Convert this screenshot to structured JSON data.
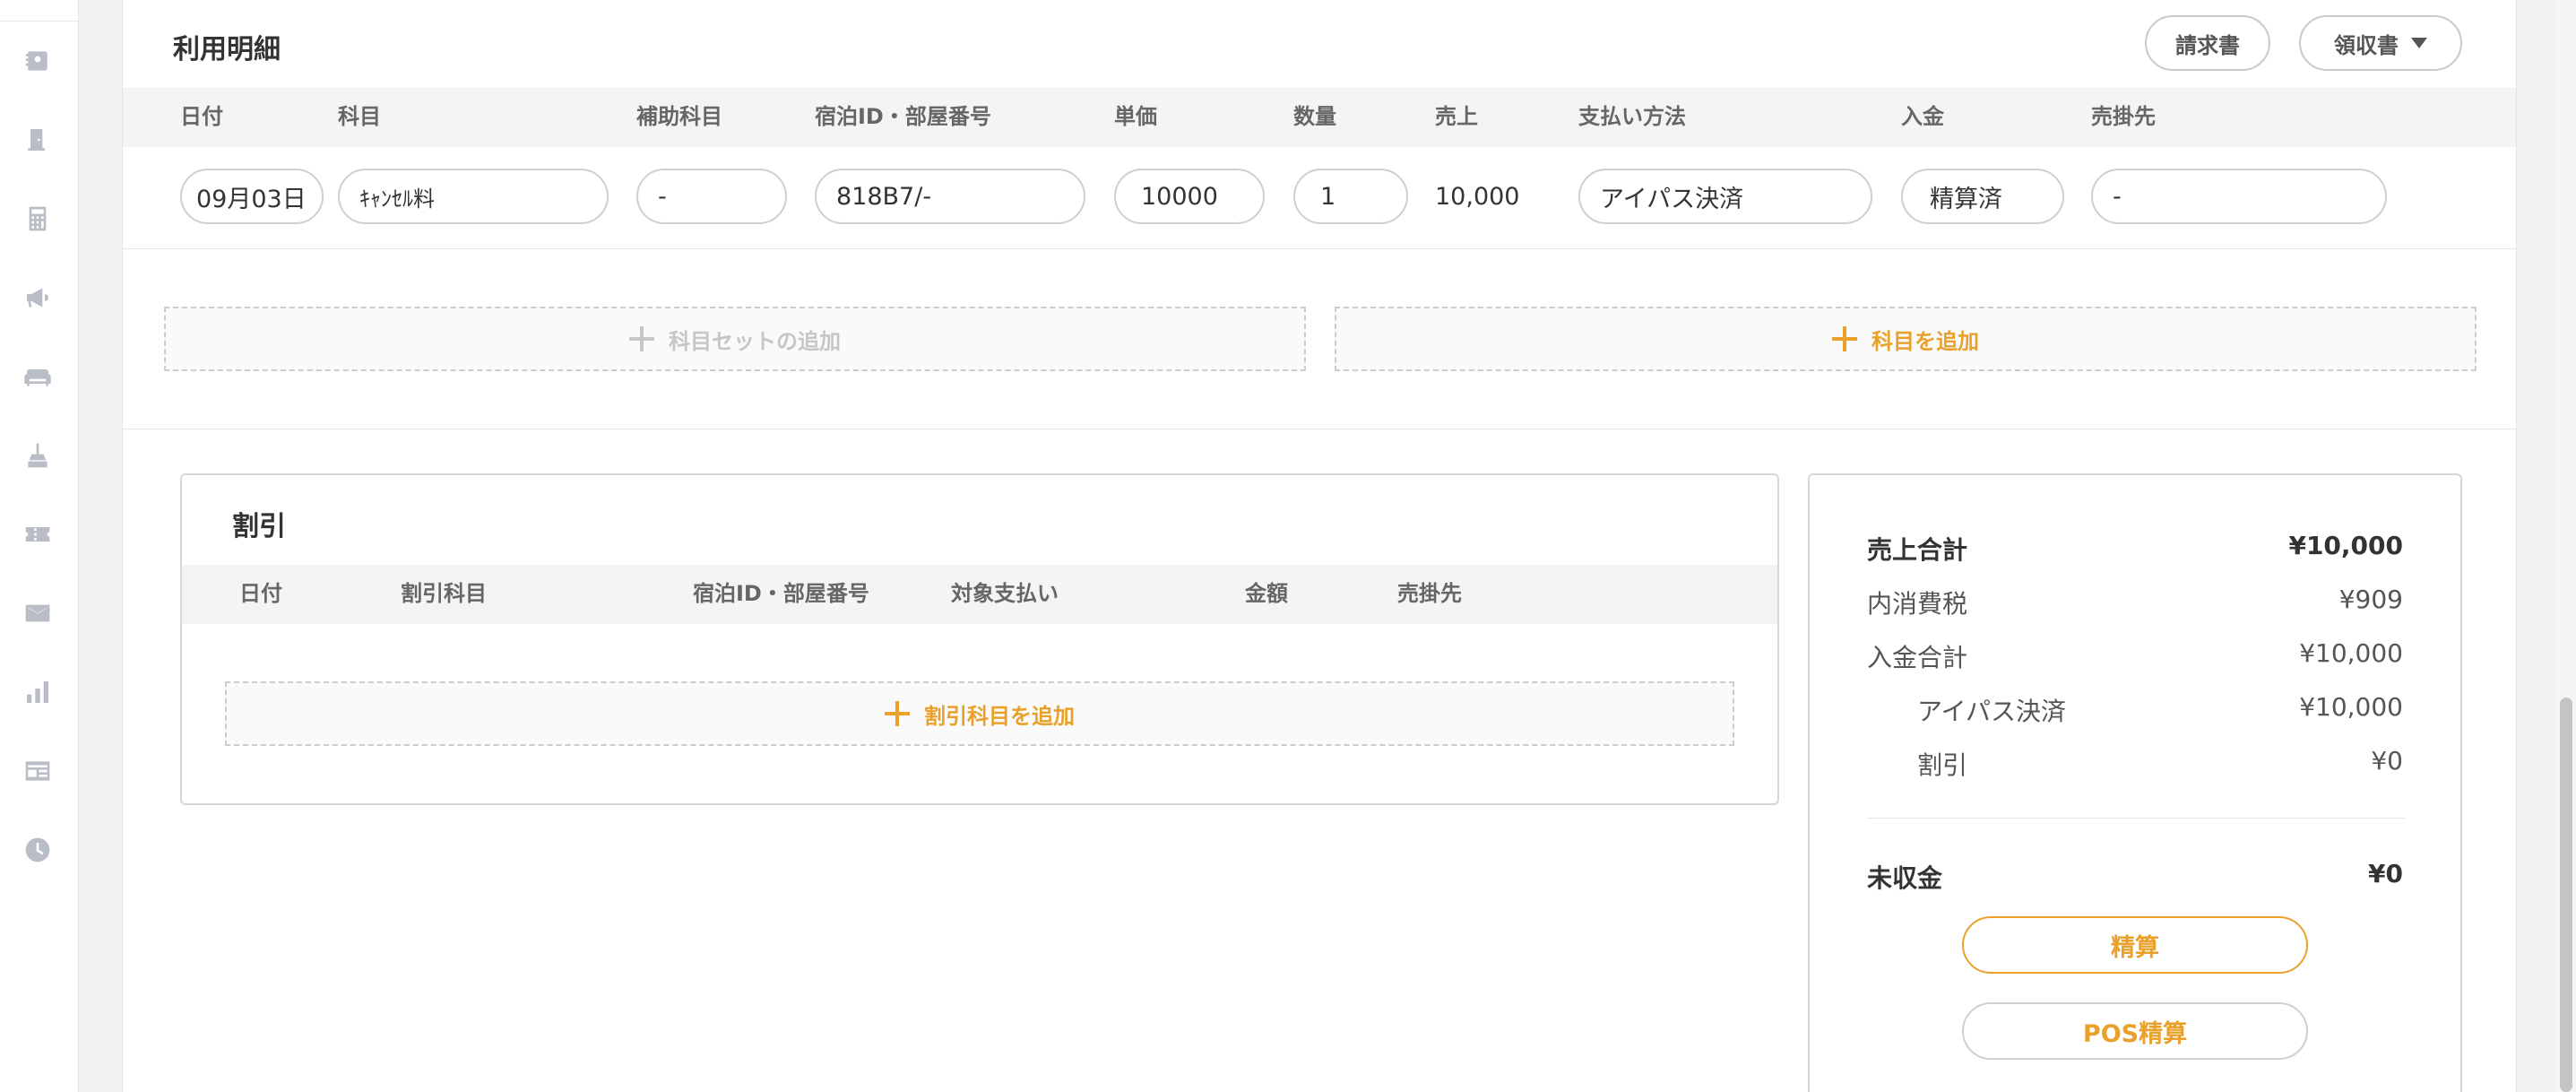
{
  "sidebar": {
    "icons": [
      "contact-book-icon",
      "door-icon",
      "calculator-icon",
      "megaphone-icon",
      "sofa-icon",
      "broom-icon",
      "ticket-icon",
      "mail-icon",
      "bar-chart-icon",
      "news-icon",
      "clock-icon"
    ]
  },
  "usage": {
    "title": "利用明細",
    "invoice_label": "請求書",
    "receipt_label": "領収書",
    "headers": {
      "date": "日付",
      "item": "科目",
      "sub_item": "補助科目",
      "stay_room": "宿泊ID・部屋番号",
      "unit_price": "単価",
      "qty": "数量",
      "sales": "売上",
      "payment_method": "支払い方法",
      "deposit": "入金",
      "receivable": "売掛先"
    },
    "row": {
      "date": "09月03日",
      "item": "ｷｬﾝｾﾙ料",
      "sub_item": "-",
      "stay_room": "818B7/-",
      "unit_price": "10000",
      "qty": "1",
      "sales": "10,000",
      "payment_method": "アイパス決済",
      "deposit": "精算済",
      "receivable": "-"
    },
    "add_set_label": "科目セットの追加",
    "add_item_label": "科目を追加"
  },
  "discount": {
    "title": "割引",
    "headers": {
      "date": "日付",
      "item": "割引科目",
      "stay_room": "宿泊ID・部屋番号",
      "target_payment": "対象支払い",
      "amount": "金額",
      "receivable": "売掛先"
    },
    "add_label": "割引科目を追加"
  },
  "summary": {
    "sales_total_label": "売上合計",
    "sales_total": "¥10,000",
    "tax_label": "内消費税",
    "tax": "¥909",
    "deposit_total_label": "入金合計",
    "deposit_total": "¥10,000",
    "ipass_label": "アイパス決済",
    "ipass": "¥10,000",
    "discount_label": "割引",
    "discount": "¥0",
    "unpaid_label": "未収金",
    "unpaid": "¥0",
    "settle_label": "精算",
    "pos_settle_label": "POS精算"
  },
  "colors": {
    "accent": "#e9a12c",
    "sidebar_icon": "#b9bec6"
  }
}
